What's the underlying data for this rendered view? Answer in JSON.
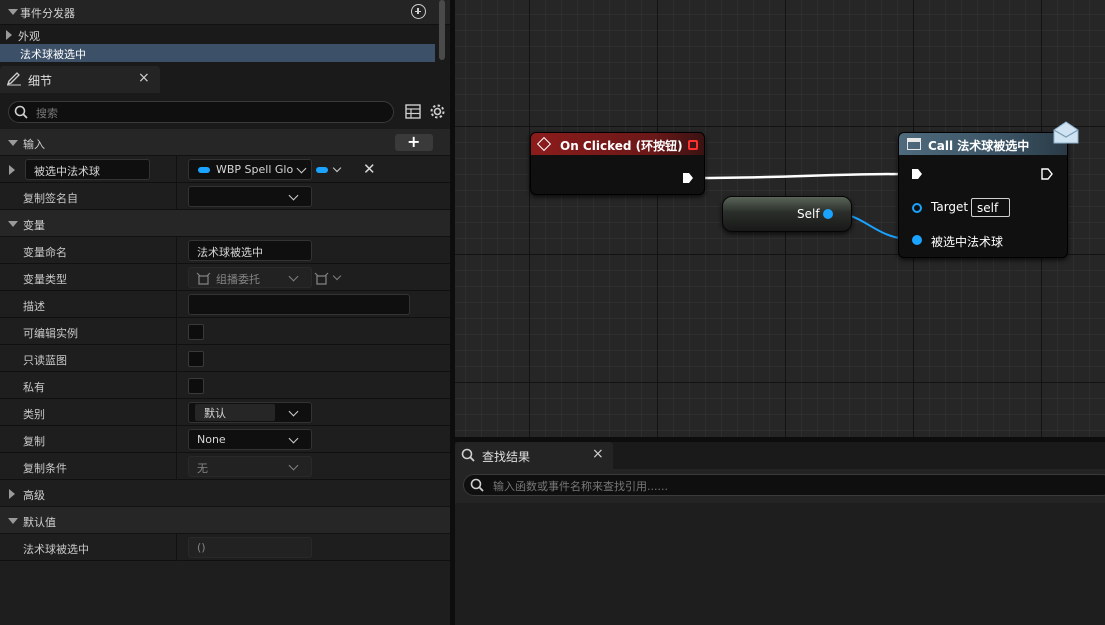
{
  "left_panel": {
    "event_dispatchers": {
      "title": "事件分发器",
      "items": [
        "外观",
        "法术球被选中"
      ]
    },
    "details_tab": {
      "title": "细节",
      "close": "×"
    },
    "search": {
      "placeholder": "搜索"
    },
    "inputs": {
      "title": "输入",
      "add": "+",
      "param_name": "被选中法术球",
      "param_type": "WBP Spell Glo",
      "remove": "✕",
      "copy_signature_label": "复制签名自"
    },
    "variables": {
      "title": "变量",
      "rows": [
        {
          "label": "变量命名",
          "value": "法术球被选中"
        },
        {
          "label": "变量类型",
          "value": "组播委托"
        },
        {
          "label": "描述",
          "value": ""
        },
        {
          "label": "可编辑实例"
        },
        {
          "label": "只读蓝图"
        },
        {
          "label": "私有"
        },
        {
          "label": "类别",
          "value": "默认"
        },
        {
          "label": "复制",
          "value": "None"
        },
        {
          "label": "复制条件",
          "value": "无"
        }
      ]
    },
    "advanced": {
      "title": "高级"
    },
    "default_value": {
      "title": "默认值",
      "label": "法术球被选中",
      "value": "()"
    }
  },
  "graph": {
    "on_clicked_node": {
      "title": "On Clicked (环按钮)"
    },
    "self_node": {
      "label": "Self"
    },
    "call_node": {
      "title": "Call 法术球被选中",
      "target_label": "Target",
      "target_value": "self",
      "param_label": "被选中法术球"
    }
  },
  "find_results": {
    "tab_title": "查找结果",
    "close": "×",
    "placeholder": "输入函数或事件名称来查找引用......"
  },
  "colors": {
    "accent_blue": "#1aa3ff",
    "event_header": "#8c1c1c",
    "call_header": "#4e6a7c",
    "selected_row": "#3c5068"
  }
}
